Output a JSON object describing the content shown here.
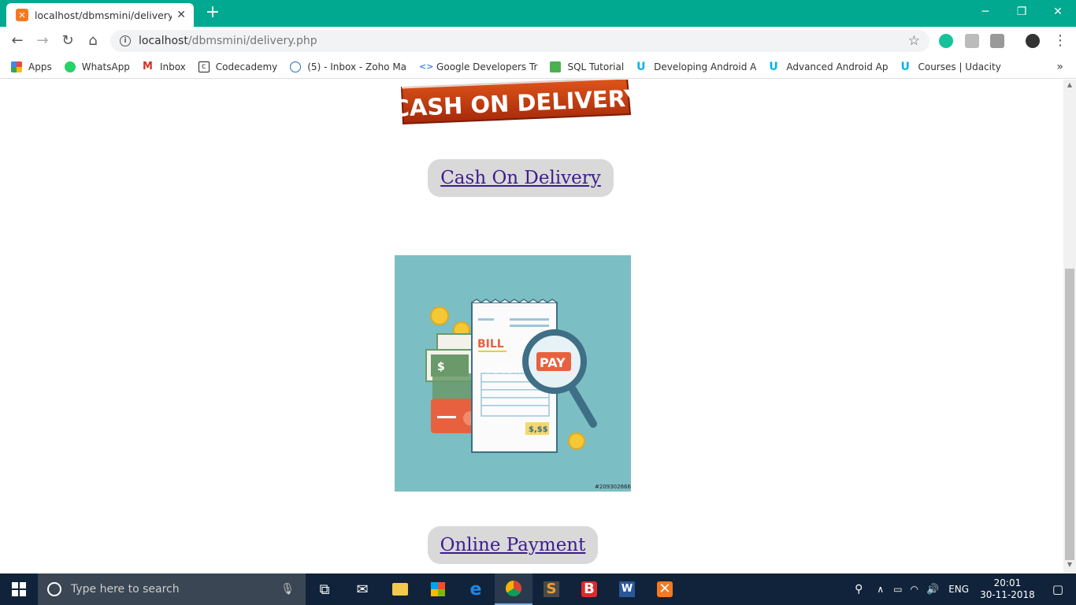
{
  "browser": {
    "tab_title": "localhost/dbmsmini/delivery.php",
    "url_host": "localhost",
    "url_path": "/dbmsmini/delivery.php"
  },
  "bookmarks": [
    {
      "label": "Apps",
      "icon": "apps-grid-icon",
      "color": "#e44"
    },
    {
      "label": "WhatsApp",
      "icon": "whatsapp-icon",
      "color": "#25d366"
    },
    {
      "label": "Inbox",
      "icon": "gmail-icon",
      "color": "#d93025"
    },
    {
      "label": "Codecademy",
      "icon": "codecademy-icon",
      "color": "#222"
    },
    {
      "label": "(5) - Inbox - Zoho Ma",
      "icon": "zoho-mail-icon",
      "color": "#2b6cb0"
    },
    {
      "label": "Google Developers Tr",
      "icon": "google-developers-icon",
      "color": "#4285f4"
    },
    {
      "label": "SQL Tutorial",
      "icon": "sql-tutorial-icon",
      "color": "#4caf50"
    },
    {
      "label": "Developing Android A",
      "icon": "udacity-icon",
      "color": "#02b3e4"
    },
    {
      "label": "Advanced Android Ap",
      "icon": "udacity-icon",
      "color": "#02b3e4"
    },
    {
      "label": "Courses | Udacity",
      "icon": "udacity-icon",
      "color": "#02b3e4"
    }
  ],
  "page": {
    "cod_banner_text": "CASH ON DELIVERY",
    "cod_link": "Cash On Delivery",
    "bill_image": {
      "bill_label": "BILL",
      "pay_label": "PAY",
      "amount_label": "$,$$",
      "watermark": "fotolia",
      "stock_id": "#209302666"
    },
    "online_link": "Online Payment"
  },
  "taskbar": {
    "search_placeholder": "Type here to search",
    "language": "ENG",
    "time": "20:01",
    "date": "30-11-2018"
  },
  "colors": {
    "chrome_accent": "#00a98f",
    "link": "#3b1d8f",
    "pill_bg": "#d9d9d9",
    "taskbar": "#10233a"
  }
}
